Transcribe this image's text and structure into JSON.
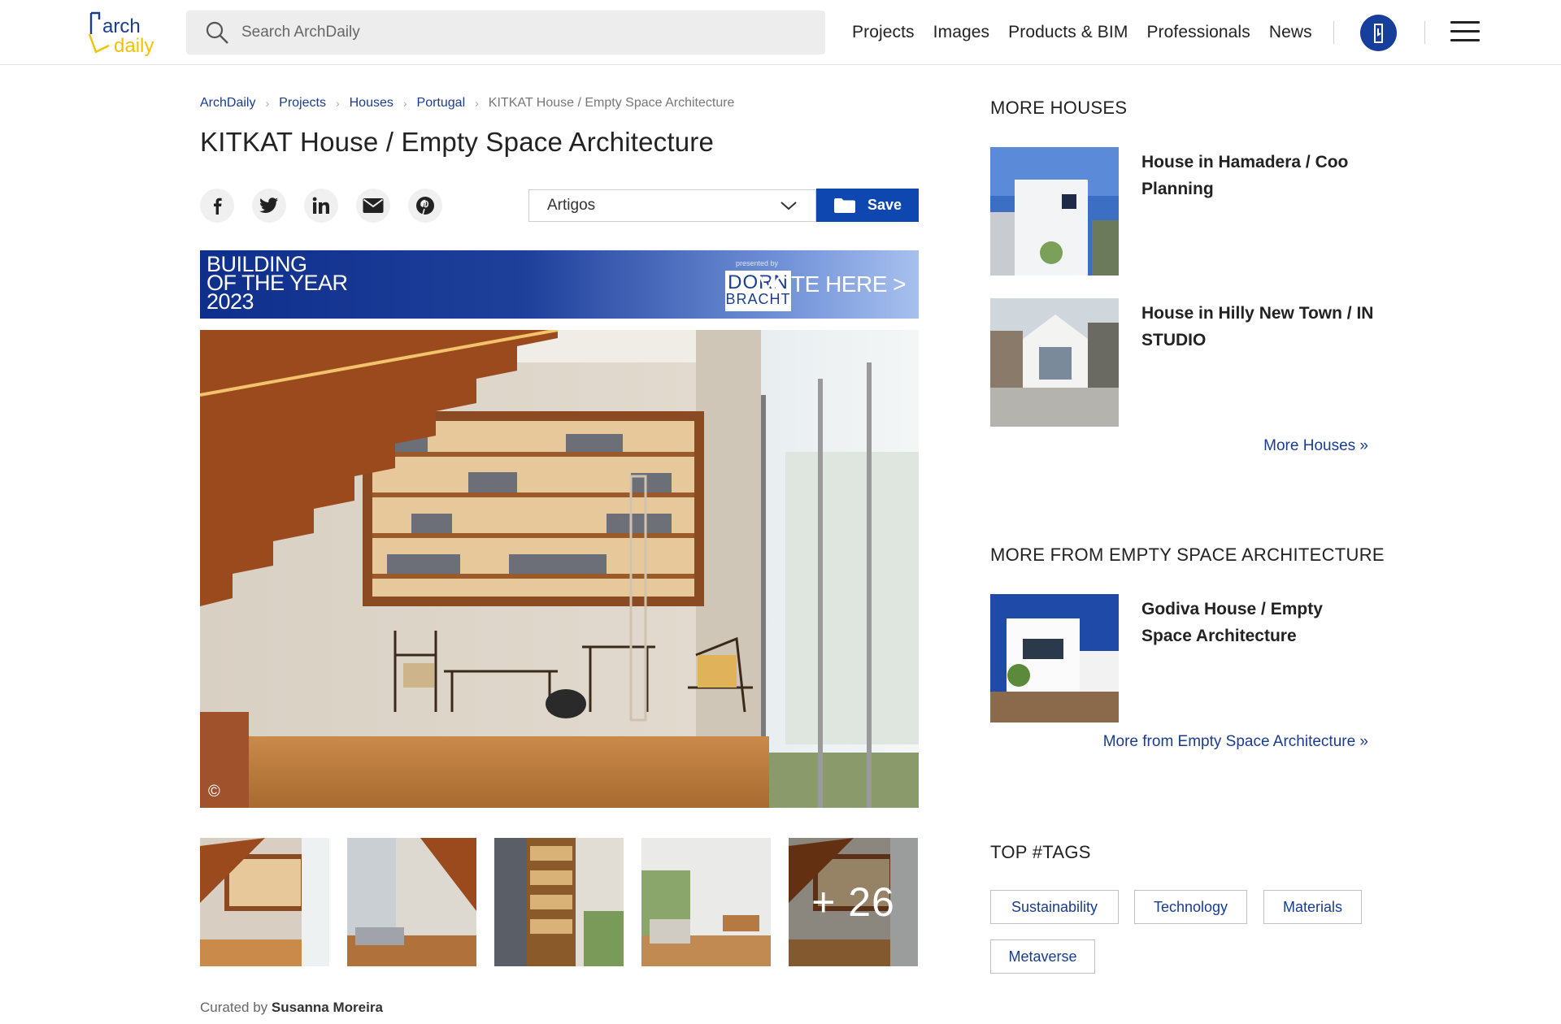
{
  "header": {
    "logo_top": "arch",
    "logo_bottom": "daily",
    "search_placeholder": "Search ArchDaily",
    "nav": [
      "Projects",
      "Images",
      "Products & BIM",
      "Professionals",
      "News"
    ]
  },
  "breadcrumb": [
    {
      "label": "ArchDaily"
    },
    {
      "label": "Projects"
    },
    {
      "label": "Houses"
    },
    {
      "label": "Portugal"
    }
  ],
  "breadcrumb_current": "KITKAT House / Empty Space Architecture",
  "title": "KITKAT House / Empty Space Architecture",
  "share": [
    "facebook-icon",
    "twitter-icon",
    "linkedin-icon",
    "email-icon",
    "pinterest-icon"
  ],
  "folder": {
    "selected": "Artigos"
  },
  "save_label": "Save",
  "banner": {
    "title": "BUILDING\nOF THE YEAR\n2023",
    "presented": "presented by",
    "sponsor_line1": "DORN",
    "sponsor_line2": "BRACHT",
    "cta": "VOTE HERE >"
  },
  "hero": {
    "copyright": "©"
  },
  "thumbs": {
    "more_count": "+ 26"
  },
  "curated": {
    "prefix": "Curated by",
    "name": "Susanna Moreira"
  },
  "sidebar": {
    "more_houses_heading": "MORE HOUSES",
    "more_houses": [
      {
        "title": "House in Hamadera / Coo Planning"
      },
      {
        "title": "House in Hilly New Town / IN STUDIO"
      }
    ],
    "more_houses_link": "More Houses »",
    "more_from_heading": "MORE FROM EMPTY SPACE ARCHITECTURE",
    "more_from": [
      {
        "title": "Godiva House / Empty Space Architecture"
      }
    ],
    "more_from_link": "More from Empty Space Architecture »",
    "tags_heading": "TOP #TAGS",
    "tags": [
      "Sustainability",
      "Technology",
      "Materials",
      "Metaverse"
    ]
  },
  "colors": {
    "brand_blue": "#1a3c8f",
    "save_blue": "#0f47b0",
    "logo_yellow": "#f2c200"
  }
}
